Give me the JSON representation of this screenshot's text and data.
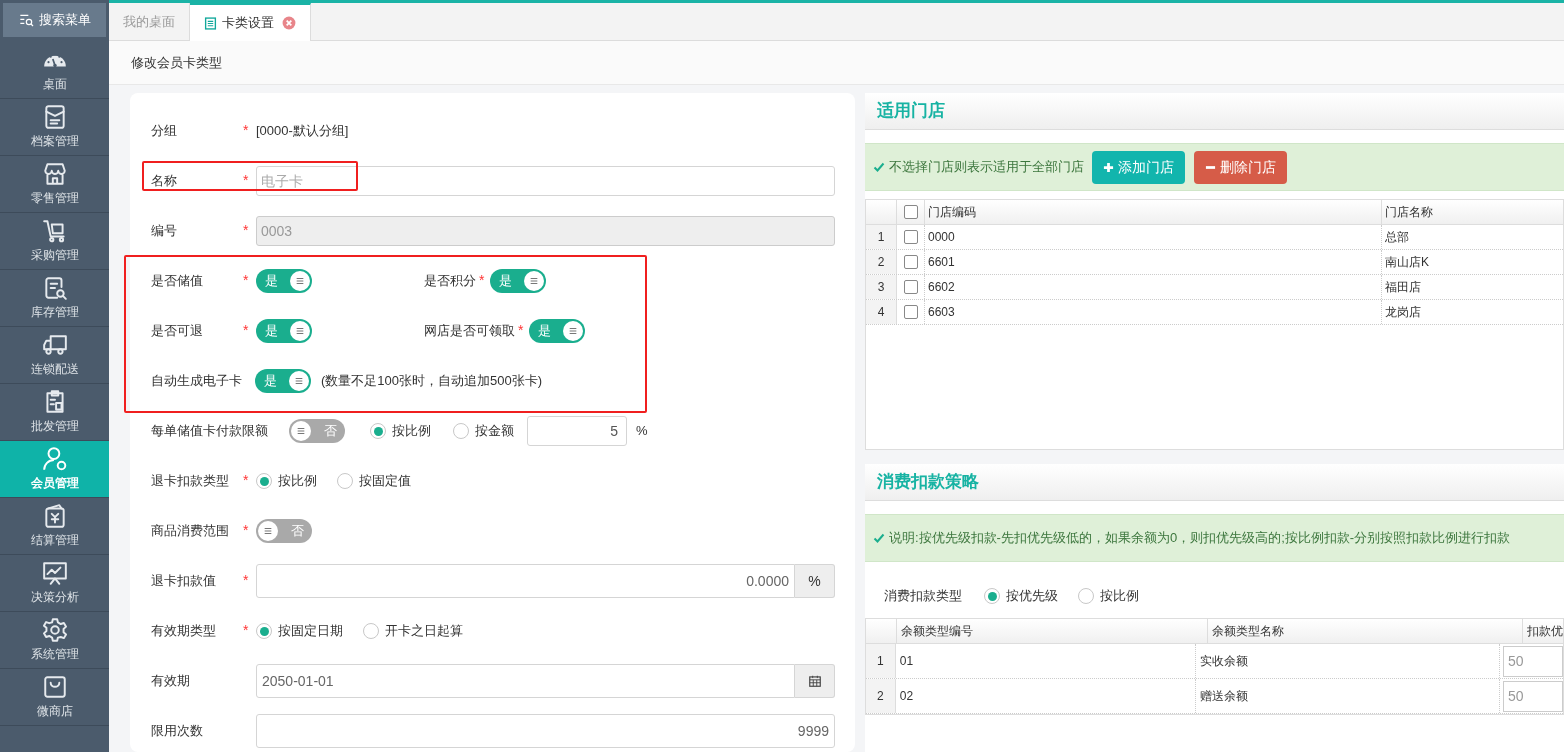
{
  "sidebar": {
    "search_button": "搜索菜单",
    "items": [
      {
        "label": "桌面",
        "selected": false
      },
      {
        "label": "档案管理",
        "selected": false
      },
      {
        "label": "零售管理",
        "selected": false
      },
      {
        "label": "采购管理",
        "selected": false
      },
      {
        "label": "库存管理",
        "selected": false
      },
      {
        "label": "连锁配送",
        "selected": false
      },
      {
        "label": "批发管理",
        "selected": false
      },
      {
        "label": "会员管理",
        "selected": true
      },
      {
        "label": "结算管理",
        "selected": false
      },
      {
        "label": "决策分析",
        "selected": false
      },
      {
        "label": "系统管理",
        "selected": false
      },
      {
        "label": "微商店",
        "selected": false
      }
    ]
  },
  "tabs": [
    {
      "label": "我的桌面",
      "selected": false,
      "closable": false
    },
    {
      "label": "卡类设置",
      "selected": true,
      "closable": true
    }
  ],
  "page_title": "修改会员卡类型",
  "form": {
    "rows": [
      {
        "kind": "static",
        "label": "分组",
        "required_mark": "*",
        "value": "[0000-默认分组]"
      },
      {
        "kind": "input",
        "label": "名称",
        "required_mark": "*",
        "placeholder": "电子卡",
        "disabled": false
      },
      {
        "kind": "input",
        "label": "编号",
        "required_mark": "*",
        "value": "0003",
        "disabled": true
      },
      {
        "kind": "toggle_pair",
        "fields": [
          {
            "label": "是否储值",
            "required_mark": "*",
            "on": true,
            "toggle_text": "是"
          },
          {
            "label": "是否积分",
            "required_mark": "*",
            "on": true,
            "toggle_text": "是"
          }
        ]
      },
      {
        "kind": "toggle_pair",
        "fields": [
          {
            "label": "是否可退",
            "required_mark": "*",
            "on": true,
            "toggle_text": "是"
          },
          {
            "label": "网店是否可领取",
            "required_mark": "*",
            "on": true,
            "toggle_text": "是"
          }
        ]
      },
      {
        "kind": "toggle",
        "label": "自动生成电子卡",
        "on": true,
        "toggle_text": "是",
        "note": "(数量不足100张时，自动追加500张卡)"
      },
      {
        "kind": "limit",
        "label": "每单储值卡付款限额",
        "on": false,
        "toggle_text": "否",
        "options": [
          {
            "label": "按比例",
            "selected": true
          },
          {
            "label": "按金额",
            "selected": false
          }
        ],
        "value": "5",
        "unit": "%"
      },
      {
        "kind": "radio",
        "label": "退卡扣款类型",
        "required_mark": "*",
        "options": [
          {
            "label": "按比例",
            "selected": true
          },
          {
            "label": "按固定值",
            "selected": false
          }
        ]
      },
      {
        "kind": "toggle",
        "label": "商品消费范围",
        "required_mark": "*",
        "on": false,
        "toggle_text": "否"
      },
      {
        "kind": "number",
        "label": "退卡扣款值",
        "required_mark": "*",
        "value": "0.0000",
        "addon": "%"
      },
      {
        "kind": "radio",
        "label": "有效期类型",
        "required_mark": "*",
        "options": [
          {
            "label": "按固定日期",
            "selected": true
          },
          {
            "label": "开卡之日起算",
            "selected": false
          }
        ]
      },
      {
        "kind": "date",
        "label": "有效期",
        "value": "2050-01-01"
      },
      {
        "kind": "number",
        "label": "限用次数",
        "value": "9999"
      }
    ]
  },
  "stores_panel": {
    "title": "适用门店",
    "notice": "不选择门店则表示适用于全部门店",
    "add_button": "添加门店",
    "delete_button": "删除门店",
    "table": {
      "columns": [
        "门店编码",
        "门店名称"
      ],
      "all_checked": false,
      "rows": [
        {
          "number": "1",
          "checked": false,
          "cells": [
            "0000",
            "总部"
          ]
        },
        {
          "number": "2",
          "checked": false,
          "cells": [
            "6601",
            "南山店K"
          ]
        },
        {
          "number": "3",
          "checked": false,
          "cells": [
            "6602",
            "福田店"
          ]
        },
        {
          "number": "4",
          "checked": false,
          "cells": [
            "6603",
            "龙岗店"
          ]
        }
      ]
    }
  },
  "deduction_panel": {
    "title": "消费扣款策略",
    "notice": "说明:按优先级扣款-先扣优先级低的，如果余额为0，则扣优先级高的;按比例扣款-分别按照扣款比例进行扣款",
    "type_label": "消费扣款类型",
    "options": [
      {
        "label": "按优先级",
        "selected": true
      },
      {
        "label": "按比例",
        "selected": false
      }
    ],
    "table": {
      "columns": [
        "余额类型编号",
        "余额类型名称",
        "扣款优"
      ],
      "rows": [
        {
          "number": "1",
          "cells": [
            "01",
            "实收余额",
            "50"
          ]
        },
        {
          "number": "2",
          "cells": [
            "02",
            "赠送余额",
            "50"
          ]
        }
      ]
    }
  }
}
